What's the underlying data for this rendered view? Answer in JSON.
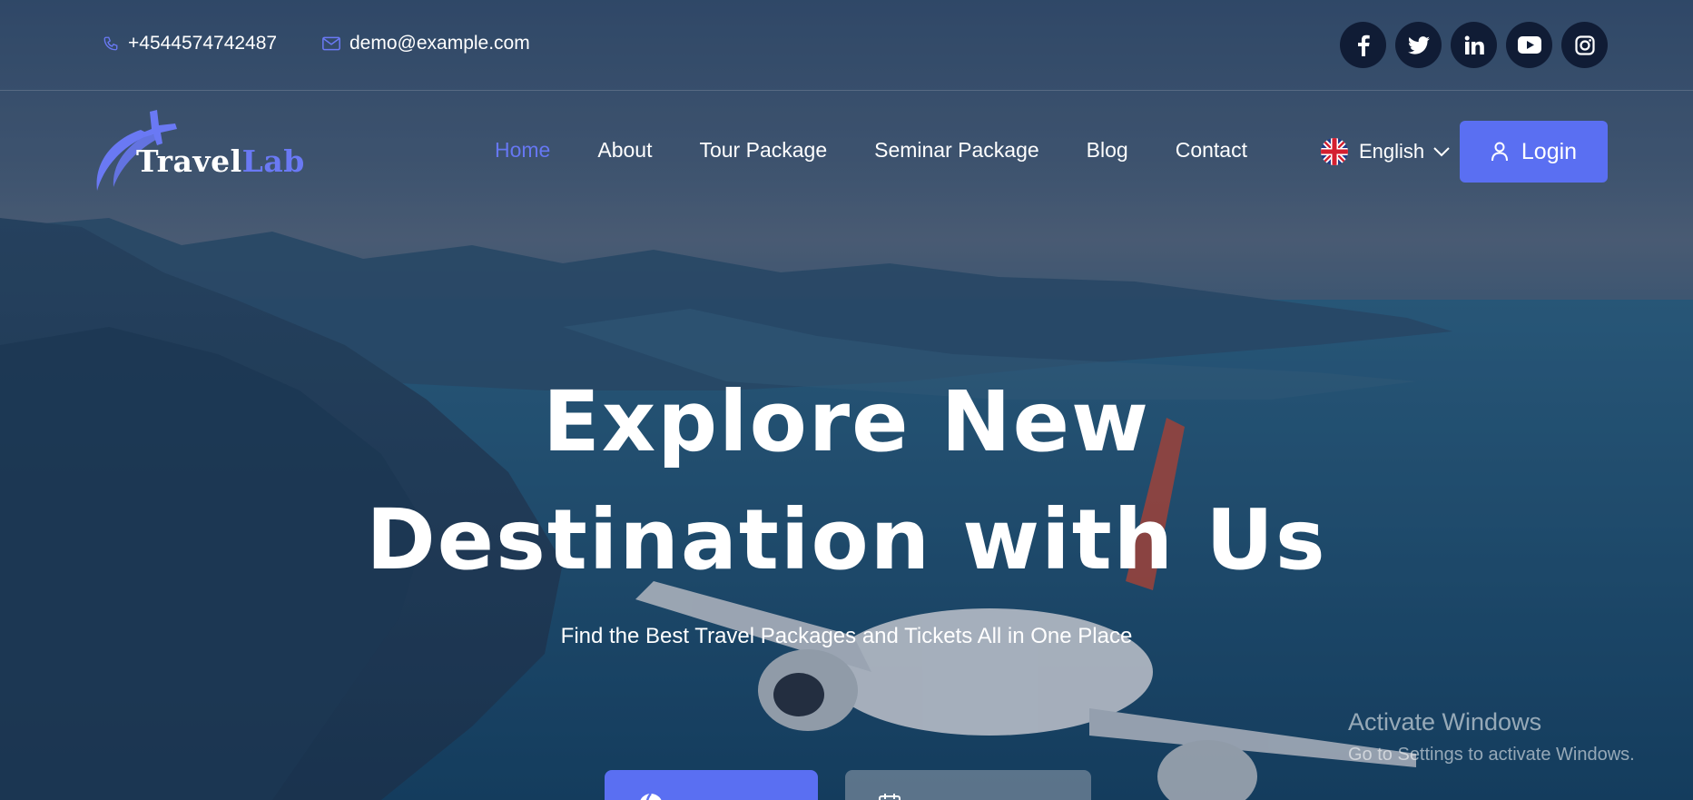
{
  "topbar": {
    "phone": "+4544574742487",
    "email": "demo@example.com",
    "socials": [
      "facebook-icon",
      "twitter-icon",
      "linkedin-icon",
      "youtube-icon",
      "instagram-icon"
    ]
  },
  "brand": {
    "part1": "Travel",
    "part2": "Lab"
  },
  "nav": {
    "items": [
      {
        "label": "Home",
        "active": true
      },
      {
        "label": "About",
        "active": false
      },
      {
        "label": "Tour Package",
        "active": false
      },
      {
        "label": "Seminar Package",
        "active": false
      },
      {
        "label": "Blog",
        "active": false
      },
      {
        "label": "Contact",
        "active": false
      }
    ],
    "language": "English",
    "login_label": "Login"
  },
  "hero": {
    "headline_line1": "Explore New",
    "headline_line2": "Destination with Us",
    "subtitle": "Find the Best Travel Packages and Tickets All in One Place"
  },
  "os_watermark": {
    "title": "Activate Windows",
    "subtitle": "Go to Settings to activate Windows."
  },
  "colors": {
    "accent": "#5a6ff2",
    "social_bg": "#101c35",
    "nav_active": "#6677f2"
  }
}
